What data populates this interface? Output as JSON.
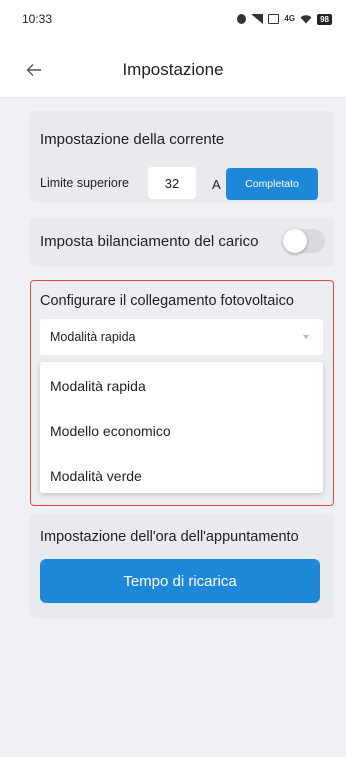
{
  "status_bar": {
    "time": "10:33",
    "network": "4G",
    "battery": "98"
  },
  "header": {
    "title": "Impostazione",
    "back_icon": "arrow-left-icon"
  },
  "current_setting": {
    "title": "Impostazione della corrente",
    "limit_label": "Limite superiore",
    "limit_value": "32",
    "unit": "A",
    "complete_button": "Completato"
  },
  "load_balance": {
    "label": "Imposta bilanciamento del carico",
    "enabled": false
  },
  "pv_connection": {
    "title": "Configurare il collegamento fotovoltaico",
    "selected_value": "Modalità rapida",
    "options": [
      "Modalità rapida",
      "Modello economico",
      "Modalità verde"
    ]
  },
  "appointment": {
    "title": "Impostazione dell'ora dell'appuntamento",
    "charge_button": "Tempo di ricarica"
  },
  "colors": {
    "accent": "#1e88d8",
    "highlight_border": "#e24c3a",
    "background": "#f0f1f4"
  }
}
